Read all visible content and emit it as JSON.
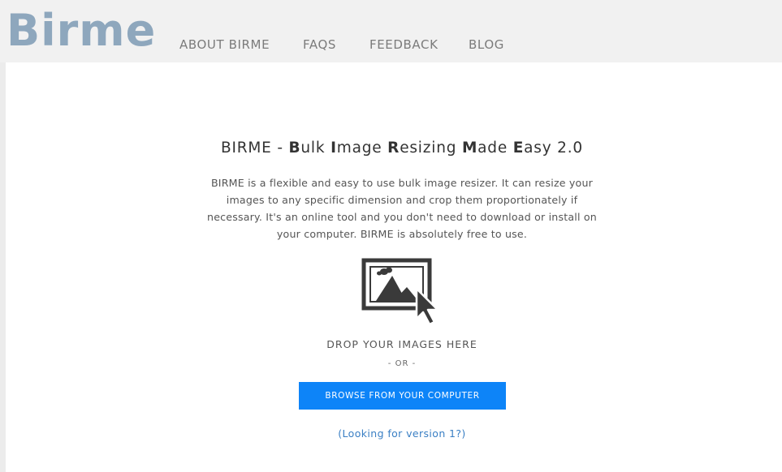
{
  "header": {
    "logo_text": "Birme",
    "nav": [
      {
        "label": "ABOUT BIRME"
      },
      {
        "label": "FAQS"
      },
      {
        "label": "FEEDBACK"
      },
      {
        "label": "BLOG"
      }
    ]
  },
  "main": {
    "title_parts": [
      "BIRME - ",
      "B",
      "ulk ",
      "I",
      "mage ",
      "R",
      "esizing ",
      "M",
      "ade ",
      "E",
      "asy 2.0"
    ],
    "description": "BIRME is a flexible and easy to use bulk image resizer. It can resize your images to any specific dimension and crop them proportionately if necessary. It's an online tool and you don't need to download or install on your computer. BIRME is absolutely free to use.",
    "drop_icon": "image-upload-cursor-icon",
    "drop_label": "DROP YOUR IMAGES HERE",
    "or_label": "- OR -",
    "browse_button": "BROWSE FROM YOUR COMPUTER",
    "version_link": "(Looking for version 1?)"
  },
  "colors": {
    "logo": "#8ea7bd",
    "nav_text": "#7b7b7b",
    "button_bg": "#0d84f8",
    "link": "#3a7fc4",
    "header_bg": "#f1f1f1"
  }
}
